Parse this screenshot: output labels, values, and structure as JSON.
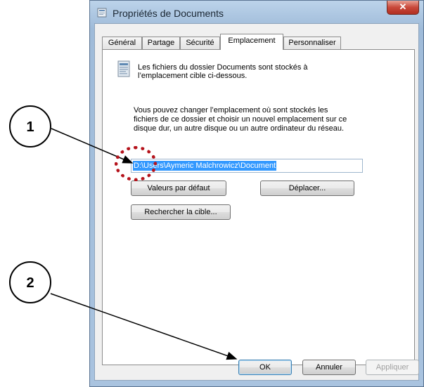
{
  "window": {
    "title": "Propriétés de Documents",
    "close_symbol": "✕"
  },
  "tabs": [
    {
      "label": "Général"
    },
    {
      "label": "Partage"
    },
    {
      "label": "Sécurité"
    },
    {
      "label": "Emplacement",
      "active": true
    },
    {
      "label": "Personnaliser"
    }
  ],
  "panel": {
    "info_line1": "Les fichiers du dossier Documents sont stockés à",
    "info_line2": "l’emplacement cible ci-dessous.",
    "desc_line1": "Vous pouvez changer l’emplacement où sont stockés les",
    "desc_line2": "fichiers de ce dossier et choisir un nouvel emplacement sur ce",
    "desc_line3": "disque dur, un autre disque ou un autre ordinateur du réseau.",
    "path_value": "D:\\Users\\Aymeric Malchrowicz\\Document",
    "restore_default_label": "Valeurs par défaut",
    "move_label": "Déplacer...",
    "find_target_label": "Rechercher la cible..."
  },
  "footer": {
    "ok_label": "OK",
    "cancel_label": "Annuler",
    "apply_label": "Appliquer"
  },
  "annotations": {
    "callout1": "1",
    "callout2": "2",
    "highlight_color": "#b5121b"
  },
  "icons": {
    "app_icon": "folder-properties-icon",
    "info_icon": "documents-folder-icon"
  }
}
